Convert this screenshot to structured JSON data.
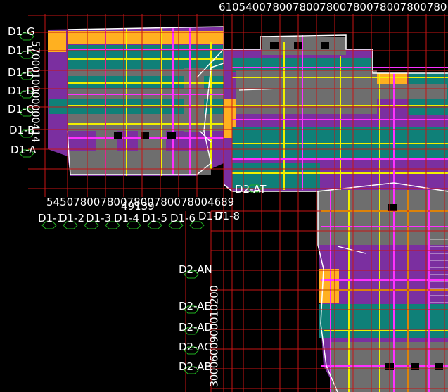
{
  "colors": {
    "background": "#000000",
    "grid": "#c81414",
    "purple": "#7b2fa0",
    "teal": "#0f8078",
    "gray": "#6e6e6e",
    "yellow": "#f0f000",
    "magenta": "#ff30ff",
    "orange": "#ffb020",
    "white": "#ffffff",
    "bubble": "#20b020"
  },
  "top_dims": "6105400780078007800780078007800780",
  "axis_labels_left_d1": [
    "D1-G",
    "D1-F",
    "D1-E",
    "D1-D",
    "D1-C",
    "D1-B",
    "D1-A"
  ],
  "vertical_dims_d1": "5700010000000414",
  "bottom_dims_d1": "5450780078007800780078004689",
  "bottom_dim_extra": "49139",
  "axis_labels_bottom_d1": [
    "D1-1",
    "D1-2",
    "D1-3",
    "D1-4",
    "D1-5",
    "D1-6",
    "D1-7",
    "D1-8"
  ],
  "d2_top_label": "D2-AT",
  "axis_labels_left_d2": [
    "D2-AN",
    "D2-AE",
    "D2-AD",
    "D2-AC",
    "D2-AB"
  ],
  "vertical_dims_d2": "3000600900010200",
  "icons": {
    "axis_bubble": "hexagon-axis-bubble-icon"
  }
}
